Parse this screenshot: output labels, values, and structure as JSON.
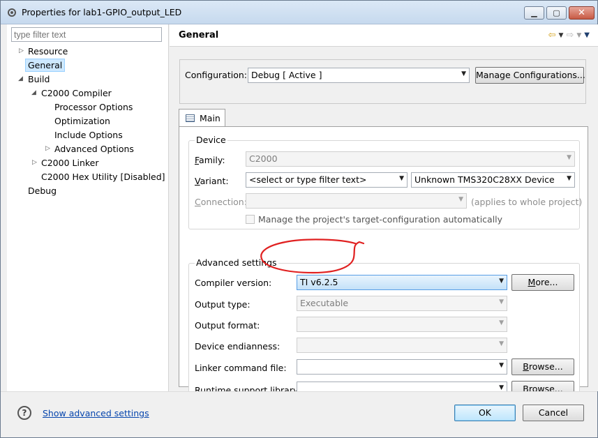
{
  "window": {
    "title": "Properties for lab1-GPIO_output_LED"
  },
  "filter": {
    "placeholder": "type filter text"
  },
  "tree": {
    "resource": "Resource",
    "general": "General",
    "build": "Build",
    "c2000_compiler": "C2000 Compiler",
    "processor_options": "Processor Options",
    "optimization": "Optimization",
    "include_options": "Include Options",
    "advanced_options": "Advanced Options",
    "c2000_linker": "C2000 Linker",
    "c2000_hex_utility": "C2000 Hex Utility  [Disabled]",
    "debug": "Debug"
  },
  "page": {
    "title": "General"
  },
  "configuration": {
    "label": "Configuration:",
    "value": "Debug  [ Active ]",
    "manage_button": "Manage Configurations..."
  },
  "tab": {
    "main": "Main"
  },
  "device": {
    "group_title": "Device",
    "family_label_u": "F",
    "family_label_rest": "amily:",
    "family_value": "C2000",
    "variant_label_u": "V",
    "variant_label_rest": "ariant:",
    "variant_filter": "<select or type filter text>",
    "variant_value": "Unknown TMS320C28XX Device",
    "connection_label_u": "C",
    "connection_label_rest": "onnection:",
    "connection_note": "(applies to whole project)",
    "manage_checkbox_label": "Manage the project's target-configuration automatically"
  },
  "advanced": {
    "group_title": "Advanced settings",
    "compiler_version_label": "Compiler version:",
    "compiler_version_value": "TI v6.2.5",
    "more_button_u": "M",
    "more_button_rest": "ore...",
    "output_type_label": "Output type:",
    "output_type_value": "Executable",
    "output_format_label": "Output format:",
    "device_endianness_label": "Device endianness:",
    "linker_cmd_label": "Linker command file:",
    "runtime_lib_label": "Runtime support library:",
    "browse_u": "B",
    "browse_rest": "rowse..."
  },
  "footer": {
    "help_glyph": "?",
    "show_advanced": "Show advanced settings",
    "ok": "OK",
    "cancel": "Cancel"
  },
  "colors": {
    "annotation": "#e02020",
    "link": "#0645ad",
    "selection": "#cde8ff"
  }
}
